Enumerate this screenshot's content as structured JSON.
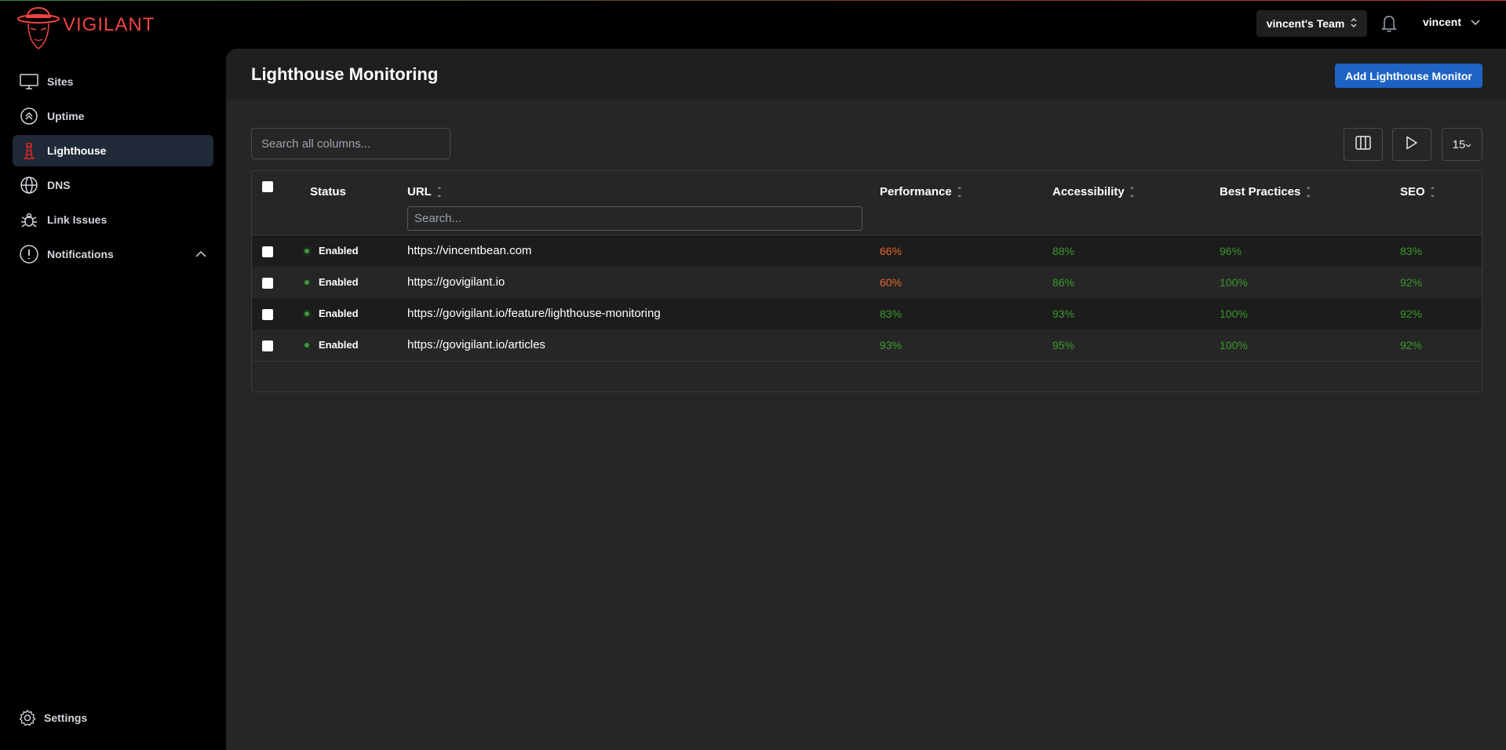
{
  "app": {
    "name": "VIGILANT"
  },
  "sidebar": {
    "items": [
      {
        "label": "Sites",
        "icon": "monitor-icon"
      },
      {
        "label": "Uptime",
        "icon": "chevrons-up-circle-icon"
      },
      {
        "label": "Lighthouse",
        "icon": "lighthouse-icon",
        "active": true
      },
      {
        "label": "DNS",
        "icon": "globe-icon"
      },
      {
        "label": "Link Issues",
        "icon": "bug-icon"
      },
      {
        "label": "Notifications",
        "icon": "alert-circle-icon"
      }
    ],
    "settings_label": "Settings"
  },
  "header": {
    "team": "vincent's Team",
    "user": "vincent"
  },
  "main": {
    "title": "Lighthouse Monitoring",
    "add_button": "Add Lighthouse Monitor",
    "search_placeholder": "Search all columns...",
    "page_size": "15",
    "url_search_placeholder": "Search..."
  },
  "table": {
    "columns": [
      "Status",
      "URL",
      "Performance",
      "Accessibility",
      "Best Practices",
      "SEO"
    ],
    "rows": [
      {
        "status": "Enabled",
        "url": "https://vincentbean.com",
        "performance": "66%",
        "accessibility": "88%",
        "best_practices": "96%",
        "seo": "83%"
      },
      {
        "status": "Enabled",
        "url": "https://govigilant.io",
        "performance": "60%",
        "accessibility": "86%",
        "best_practices": "100%",
        "seo": "92%"
      },
      {
        "status": "Enabled",
        "url": "https://govigilant.io/feature/lighthouse-monitoring",
        "performance": "83%",
        "accessibility": "93%",
        "best_practices": "100%",
        "seo": "92%"
      },
      {
        "status": "Enabled",
        "url": "https://govigilant.io/articles",
        "performance": "93%",
        "accessibility": "95%",
        "best_practices": "100%",
        "seo": "92%"
      }
    ]
  },
  "colors": {
    "score_good": "#3a9a2a",
    "score_warn": "#e2662a",
    "accent": "#1d63c4",
    "brand": "#ef4444"
  }
}
